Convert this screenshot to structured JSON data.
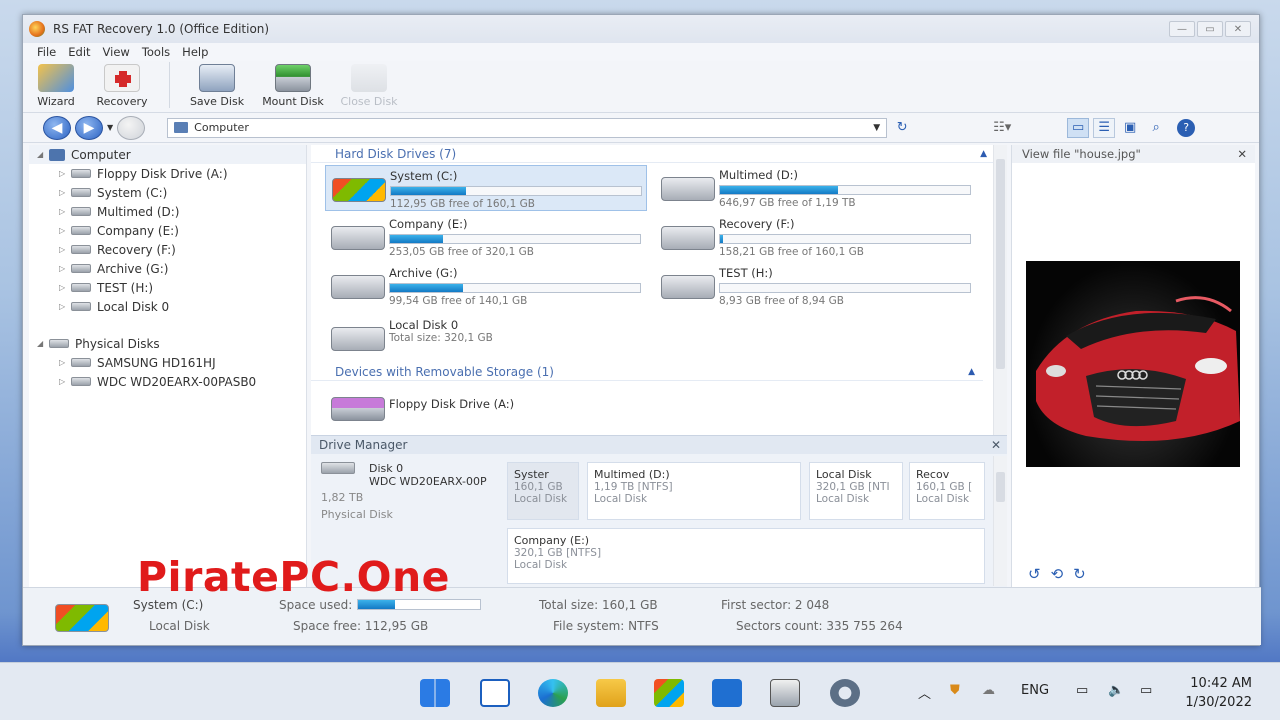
{
  "window": {
    "title": "RS FAT Recovery 1.0 (Office Edition)"
  },
  "menu": [
    "File",
    "Edit",
    "View",
    "Tools",
    "Help"
  ],
  "toolbar": {
    "wizard": "Wizard",
    "recovery": "Recovery",
    "save_disk": "Save Disk",
    "mount_disk": "Mount Disk",
    "close_disk": "Close Disk"
  },
  "address": {
    "path": "Computer"
  },
  "tree": {
    "root": "Computer",
    "drives": [
      "Floppy Disk Drive (A:)",
      "System (C:)",
      "Multimed (D:)",
      "Company (E:)",
      "Recovery (F:)",
      "Archive (G:)",
      "TEST (H:)",
      "Local Disk 0"
    ],
    "physical_root": "Physical Disks",
    "physical": [
      "SAMSUNG HD161HJ",
      "WDC WD20EARX-00PASB0"
    ]
  },
  "sections": {
    "hdd": "Hard Disk Drives (7)",
    "removable": "Devices with Removable Storage (1)"
  },
  "drives": [
    {
      "name": "System (C:)",
      "free": "112,95 GB free of 160,1 GB",
      "used_fraction": 0.3
    },
    {
      "name": "Multimed (D:)",
      "free": "646,97 GB free of 1,19 TB",
      "used_fraction": 0.47
    },
    {
      "name": "Company (E:)",
      "free": "253,05 GB free of 320,1 GB",
      "used_fraction": 0.21
    },
    {
      "name": "Recovery (F:)",
      "free": "158,21 GB free of 160,1 GB",
      "used_fraction": 0.01
    },
    {
      "name": "Archive (G:)",
      "free": "99,54 GB free of 140,1 GB",
      "used_fraction": 0.29
    },
    {
      "name": "TEST (H:)",
      "free": "8,93 GB free of 8,94 GB",
      "used_fraction": 0.0
    }
  ],
  "local_disk": {
    "name": "Local Disk 0",
    "total": "Total size: 320,1 GB"
  },
  "floppy": {
    "name": "Floppy Disk Drive (A:)"
  },
  "drive_manager": {
    "title": "Drive Manager",
    "disk_name": "Disk 0",
    "disk_model": "WDC WD20EARX-00P",
    "disk_size": "1,82 TB",
    "disk_type": "Physical Disk",
    "parts": [
      {
        "name": "Syster",
        "size": "160,1 GB",
        "type": "Local Disk"
      },
      {
        "name": "Multimed (D:)",
        "size": "1,19 TB [NTFS]",
        "type": "Local Disk"
      },
      {
        "name": "Local Disk",
        "size": "320,1 GB [NTI",
        "type": "Local Disk"
      },
      {
        "name": "Recov",
        "size": "160,1 GB [",
        "type": "Local Disk"
      },
      {
        "name": "Company (E:)",
        "size": "320,1 GB [NTFS]",
        "type": "Local Disk"
      }
    ]
  },
  "preview": {
    "title": "View file \"house.jpg\""
  },
  "status": {
    "name": "System (C:)",
    "type": "Local Disk",
    "space_used_label": "Space used:",
    "space_used_fraction": 0.3,
    "space_free": "Space free: 112,95 GB",
    "total_size": "Total size: 160,1 GB",
    "file_system": "File system: NTFS",
    "first_sector": "First sector: 2 048",
    "sectors_count": "Sectors count: 335 755 264"
  },
  "watermark": "PiratePC.One",
  "taskbar": {
    "lang": "ENG",
    "time": "10:42 AM",
    "date": "1/30/2022"
  },
  "colors": {
    "accent": "#1379c5",
    "section": "#4a6fb0",
    "watermark": "#e01b1b"
  }
}
